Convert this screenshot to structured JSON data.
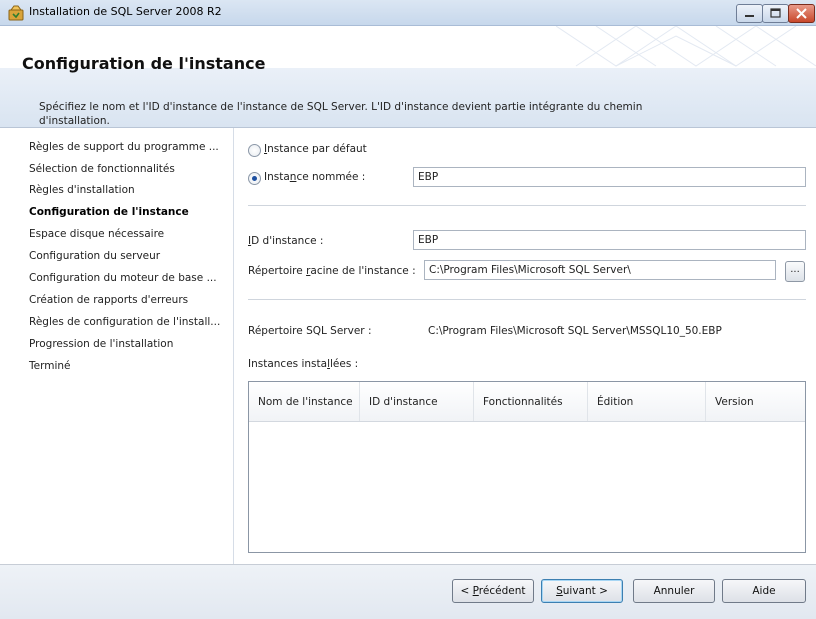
{
  "window": {
    "title": "Installation de SQL Server 2008 R2"
  },
  "header": {
    "title": "Configuration de l'instance",
    "description": "Spécifiez le nom et l'ID d'instance de l'instance de SQL Server. L'ID d'instance devient partie intégrante du chemin d'installation."
  },
  "nav": {
    "items": [
      "Règles de support du programme ...",
      "Sélection de fonctionnalités",
      "Règles d'installation",
      "Configuration de l'instance",
      "Espace disque nécessaire",
      "Configuration du serveur",
      "Configuration du moteur de base ...",
      "Création de rapports d'erreurs",
      "Règles de configuration de l'install...",
      "Progression de l'installation",
      "Terminé"
    ],
    "active_index": 3
  },
  "form": {
    "default_instance": {
      "pre": "",
      "key": "I",
      "post": "nstance par défaut"
    },
    "named_instance": {
      "pre": "Insta",
      "key": "n",
      "post": "ce nommée :"
    },
    "named_instance_value": "EBP",
    "instance_id": {
      "pre": "",
      "key": "I",
      "post": "D d'instance :"
    },
    "instance_id_value": "EBP",
    "root_dir": {
      "pre": "Répertoire ",
      "key": "r",
      "post": "acine de l'instance :"
    },
    "root_dir_value": "C:\\Program Files\\Microsoft SQL Server\\",
    "browse_label": "...",
    "sql_dir_label": "Répertoire SQL Server :",
    "sql_dir_value": "C:\\Program Files\\Microsoft SQL Server\\MSSQL10_50.EBP",
    "installed": {
      "pre": "Instances insta",
      "key": "l",
      "post": "lées :"
    }
  },
  "grid": {
    "columns": [
      "Nom de l'instance",
      "ID d'instance",
      "Fonctionnalités",
      "Édition",
      "Version"
    ]
  },
  "footer": {
    "back": {
      "pre": "< ",
      "key": "P",
      "post": "récédent"
    },
    "next": {
      "pre": "",
      "key": "S",
      "post": "uivant >"
    },
    "cancel": "Annuler",
    "help": "Aide"
  },
  "colors": {
    "accent": "#1c4fa0",
    "close_button": "#c8482b"
  }
}
